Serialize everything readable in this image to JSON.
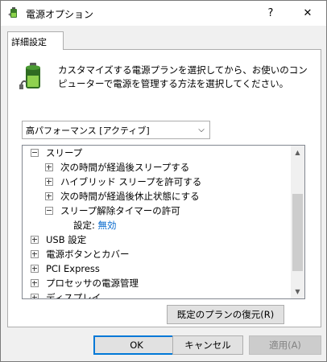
{
  "window": {
    "title": "電源オプション",
    "help": "?",
    "close": "✕"
  },
  "tab": {
    "label": "詳細設定"
  },
  "description": "カスタマイズする電源プランを選択してから、お使いのコンピューターで電源を管理する方法を選択してください。",
  "plan_select": {
    "value": "高パフォーマンス [アクティブ]"
  },
  "tree": {
    "sleep": "スリープ",
    "sleep_after": "次の時間が経過後スリープする",
    "hybrid_sleep": "ハイブリッド スリープを許可する",
    "hibernate_after": "次の時間が経過後休止状態にする",
    "wake_timers": "スリープ解除タイマーの許可",
    "setting_label": "設定:",
    "setting_value": "無効",
    "usb": "USB 設定",
    "power_buttons": "電源ボタンとカバー",
    "pci_express": "PCI Express",
    "processor": "プロセッサの電源管理",
    "display": "ディスプレイ"
  },
  "buttons": {
    "restore": "既定のプランの復元(R)",
    "ok": "OK",
    "cancel": "キャンセル",
    "apply": "適用(A)"
  },
  "colors": {
    "accent": "#0078d7",
    "link": "#0066cc"
  }
}
